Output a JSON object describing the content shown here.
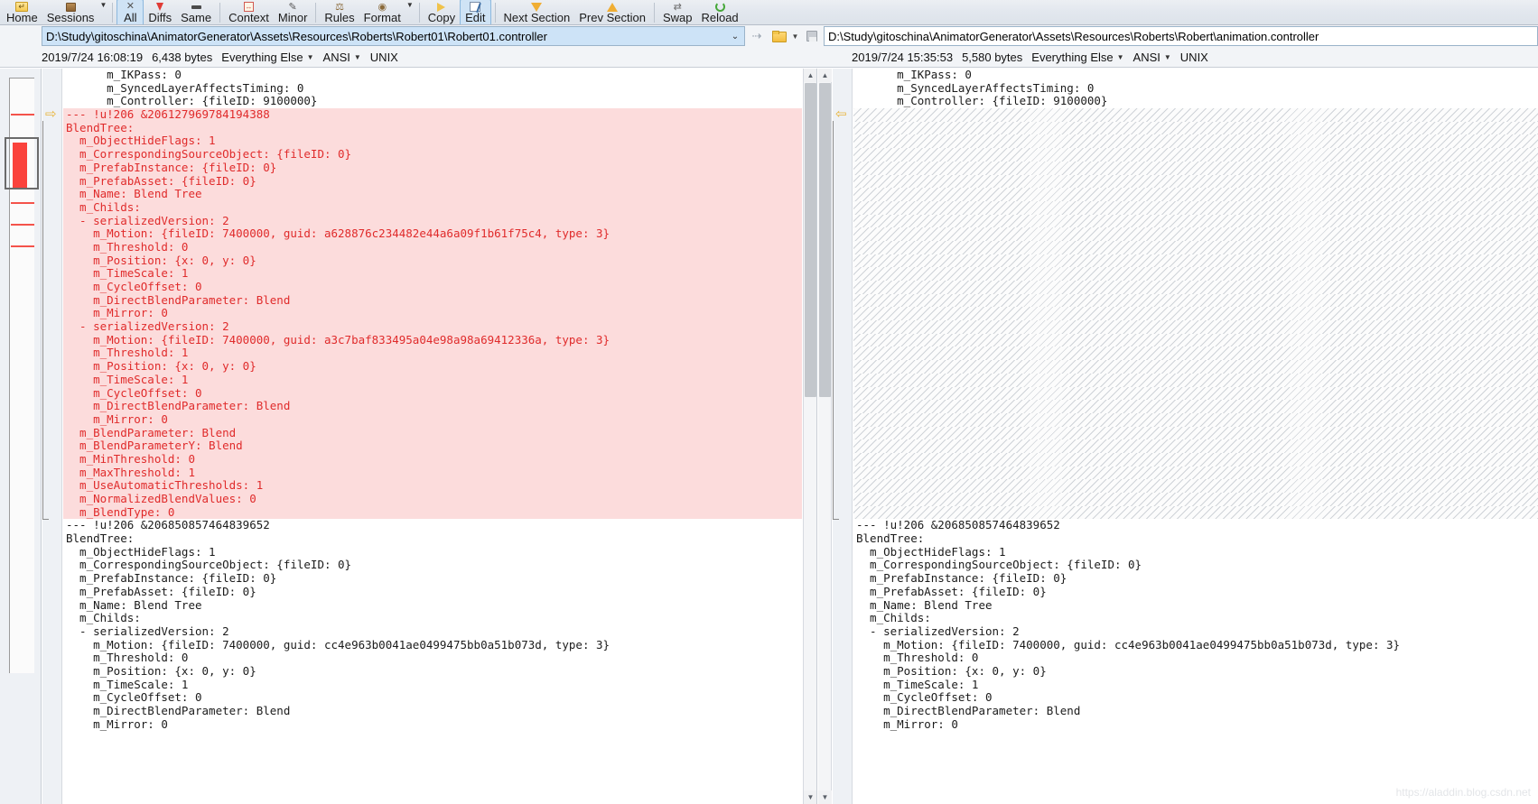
{
  "toolbar": {
    "groups": [
      {
        "items": [
          {
            "label": "Home",
            "icon": "home-folder-icon",
            "active": false
          },
          {
            "label": "Sessions",
            "icon": "sessions-box-icon",
            "active": false,
            "caret": true
          }
        ]
      },
      {
        "items": [
          {
            "label": "All",
            "icon": "all-x-icon",
            "active": true
          },
          {
            "label": "Diffs",
            "icon": "diffs-pin-icon",
            "active": false
          },
          {
            "label": "Same",
            "icon": "same-bar-icon",
            "active": false
          }
        ]
      },
      {
        "items": [
          {
            "label": "Context",
            "icon": "context-icon",
            "active": false
          },
          {
            "label": "Minor",
            "icon": "minor-icon",
            "active": false
          }
        ]
      },
      {
        "items": [
          {
            "label": "Rules",
            "icon": "rules-icon",
            "active": false
          },
          {
            "label": "Format",
            "icon": "format-icon",
            "active": false,
            "caret": true
          }
        ]
      },
      {
        "items": [
          {
            "label": "Copy",
            "icon": "copy-arrow-icon",
            "active": false
          },
          {
            "label": "Edit",
            "icon": "edit-pencil-icon",
            "active": true
          }
        ]
      },
      {
        "items": [
          {
            "label": "Next Section",
            "icon": "next-section-icon",
            "active": false
          },
          {
            "label": "Prev Section",
            "icon": "prev-section-icon",
            "active": false
          }
        ]
      },
      {
        "items": [
          {
            "label": "Swap",
            "icon": "swap-icon",
            "active": false
          },
          {
            "label": "Reload",
            "icon": "reload-icon",
            "active": false
          }
        ]
      }
    ]
  },
  "left_pane": {
    "path": "D:\\Study\\gitoschina\\AnimatorGenerator\\Assets\\Resources\\Roberts\\Robert01\\Robert01.controller",
    "info": {
      "timestamp": "2019/7/24 16:08:19",
      "size": "6,438 bytes",
      "encoding_rule": "Everything Else",
      "charset": "ANSI",
      "line_ending": "UNIX"
    },
    "path_tools": {
      "browse_icon": "navigate-icon",
      "open_icon": "open-folder-icon",
      "open_caret": "chevron-down-icon",
      "save_icon": "save-icon"
    },
    "lines": [
      {
        "text": "      m_IKPass: 0",
        "diff": false
      },
      {
        "text": "      m_SyncedLayerAffectsTiming: 0",
        "diff": false
      },
      {
        "text": "      m_Controller: {fileID: 9100000}",
        "diff": false
      },
      {
        "text": "--- !u!206 &206127969784194388",
        "diff": true
      },
      {
        "text": "BlendTree:",
        "diff": true
      },
      {
        "text": "  m_ObjectHideFlags: 1",
        "diff": true
      },
      {
        "text": "  m_CorrespondingSourceObject: {fileID: 0}",
        "diff": true
      },
      {
        "text": "  m_PrefabInstance: {fileID: 0}",
        "diff": true
      },
      {
        "text": "  m_PrefabAsset: {fileID: 0}",
        "diff": true
      },
      {
        "text": "  m_Name: Blend Tree",
        "diff": true
      },
      {
        "text": "  m_Childs:",
        "diff": true
      },
      {
        "text": "  - serializedVersion: 2",
        "diff": true
      },
      {
        "text": "    m_Motion: {fileID: 7400000, guid: a628876c234482e44a6a09f1b61f75c4, type: 3}",
        "diff": true
      },
      {
        "text": "    m_Threshold: 0",
        "diff": true
      },
      {
        "text": "    m_Position: {x: 0, y: 0}",
        "diff": true
      },
      {
        "text": "    m_TimeScale: 1",
        "diff": true
      },
      {
        "text": "    m_CycleOffset: 0",
        "diff": true
      },
      {
        "text": "    m_DirectBlendParameter: Blend",
        "diff": true
      },
      {
        "text": "    m_Mirror: 0",
        "diff": true
      },
      {
        "text": "  - serializedVersion: 2",
        "diff": true
      },
      {
        "text": "    m_Motion: {fileID: 7400000, guid: a3c7baf833495a04e98a98a69412336a, type: 3}",
        "diff": true
      },
      {
        "text": "    m_Threshold: 1",
        "diff": true
      },
      {
        "text": "    m_Position: {x: 0, y: 0}",
        "diff": true
      },
      {
        "text": "    m_TimeScale: 1",
        "diff": true
      },
      {
        "text": "    m_CycleOffset: 0",
        "diff": true
      },
      {
        "text": "    m_DirectBlendParameter: Blend",
        "diff": true
      },
      {
        "text": "    m_Mirror: 0",
        "diff": true
      },
      {
        "text": "  m_BlendParameter: Blend",
        "diff": true
      },
      {
        "text": "  m_BlendParameterY: Blend",
        "diff": true
      },
      {
        "text": "  m_MinThreshold: 0",
        "diff": true
      },
      {
        "text": "  m_MaxThreshold: 1",
        "diff": true
      },
      {
        "text": "  m_UseAutomaticThresholds: 1",
        "diff": true
      },
      {
        "text": "  m_NormalizedBlendValues: 0",
        "diff": true
      },
      {
        "text": "  m_BlendType: 0",
        "diff": true
      },
      {
        "text": "--- !u!206 &206850857464839652",
        "diff": false
      },
      {
        "text": "BlendTree:",
        "diff": false
      },
      {
        "text": "  m_ObjectHideFlags: 1",
        "diff": false
      },
      {
        "text": "  m_CorrespondingSourceObject: {fileID: 0}",
        "diff": false
      },
      {
        "text": "  m_PrefabInstance: {fileID: 0}",
        "diff": false
      },
      {
        "text": "  m_PrefabAsset: {fileID: 0}",
        "diff": false
      },
      {
        "text": "  m_Name: Blend Tree",
        "diff": false
      },
      {
        "text": "  m_Childs:",
        "diff": false
      },
      {
        "text": "  - serializedVersion: 2",
        "diff": false
      },
      {
        "text": "    m_Motion: {fileID: 7400000, guid: cc4e963b0041ae0499475bb0a51b073d, type: 3}",
        "diff": false
      },
      {
        "text": "    m_Threshold: 0",
        "diff": false
      },
      {
        "text": "    m_Position: {x: 0, y: 0}",
        "diff": false
      },
      {
        "text": "    m_TimeScale: 1",
        "diff": false
      },
      {
        "text": "    m_CycleOffset: 0",
        "diff": false
      },
      {
        "text": "    m_DirectBlendParameter: Blend",
        "diff": false
      },
      {
        "text": "    m_Mirror: 0",
        "diff": false
      }
    ]
  },
  "right_pane": {
    "path": "D:\\Study\\gitoschina\\AnimatorGenerator\\Assets\\Resources\\Roberts\\Robert\\animation.controller",
    "info": {
      "timestamp": "2019/7/24 15:35:53",
      "size": "5,580 bytes",
      "encoding_rule": "Everything Else",
      "charset": "ANSI",
      "line_ending": "UNIX"
    },
    "path_tools": {
      "browse_icon": "navigate-icon",
      "open_icon": "open-folder-icon",
      "open_caret": "chevron-down-icon",
      "save_icon": "save-icon"
    },
    "lines": [
      {
        "text": "      m_IKPass: 0",
        "diff": false,
        "hatch": false
      },
      {
        "text": "      m_SyncedLayerAffectsTiming: 0",
        "diff": false,
        "hatch": false
      },
      {
        "text": "      m_Controller: {fileID: 9100000}",
        "diff": false,
        "hatch": false
      },
      {
        "text": "",
        "diff": false,
        "hatch": true
      },
      {
        "text": "",
        "diff": false,
        "hatch": true
      },
      {
        "text": "",
        "diff": false,
        "hatch": true
      },
      {
        "text": "",
        "diff": false,
        "hatch": true
      },
      {
        "text": "",
        "diff": false,
        "hatch": true
      },
      {
        "text": "",
        "diff": false,
        "hatch": true
      },
      {
        "text": "",
        "diff": false,
        "hatch": true
      },
      {
        "text": "",
        "diff": false,
        "hatch": true
      },
      {
        "text": "",
        "diff": false,
        "hatch": true
      },
      {
        "text": "",
        "diff": false,
        "hatch": true
      },
      {
        "text": "",
        "diff": false,
        "hatch": true
      },
      {
        "text": "",
        "diff": false,
        "hatch": true
      },
      {
        "text": "",
        "diff": false,
        "hatch": true
      },
      {
        "text": "",
        "diff": false,
        "hatch": true
      },
      {
        "text": "",
        "diff": false,
        "hatch": true
      },
      {
        "text": "",
        "diff": false,
        "hatch": true
      },
      {
        "text": "",
        "diff": false,
        "hatch": true
      },
      {
        "text": "",
        "diff": false,
        "hatch": true
      },
      {
        "text": "",
        "diff": false,
        "hatch": true
      },
      {
        "text": "",
        "diff": false,
        "hatch": true
      },
      {
        "text": "",
        "diff": false,
        "hatch": true
      },
      {
        "text": "",
        "diff": false,
        "hatch": true
      },
      {
        "text": "",
        "diff": false,
        "hatch": true
      },
      {
        "text": "",
        "diff": false,
        "hatch": true
      },
      {
        "text": "",
        "diff": false,
        "hatch": true
      },
      {
        "text": "",
        "diff": false,
        "hatch": true
      },
      {
        "text": "",
        "diff": false,
        "hatch": true
      },
      {
        "text": "",
        "diff": false,
        "hatch": true
      },
      {
        "text": "",
        "diff": false,
        "hatch": true
      },
      {
        "text": "",
        "diff": false,
        "hatch": true
      },
      {
        "text": "",
        "diff": false,
        "hatch": true
      },
      {
        "text": "--- !u!206 &206850857464839652",
        "diff": false,
        "hatch": false
      },
      {
        "text": "BlendTree:",
        "diff": false,
        "hatch": false
      },
      {
        "text": "  m_ObjectHideFlags: 1",
        "diff": false,
        "hatch": false
      },
      {
        "text": "  m_CorrespondingSourceObject: {fileID: 0}",
        "diff": false,
        "hatch": false
      },
      {
        "text": "  m_PrefabInstance: {fileID: 0}",
        "diff": false,
        "hatch": false
      },
      {
        "text": "  m_PrefabAsset: {fileID: 0}",
        "diff": false,
        "hatch": false
      },
      {
        "text": "  m_Name: Blend Tree",
        "diff": false,
        "hatch": false
      },
      {
        "text": "  m_Childs:",
        "diff": false,
        "hatch": false
      },
      {
        "text": "  - serializedVersion: 2",
        "diff": false,
        "hatch": false
      },
      {
        "text": "    m_Motion: {fileID: 7400000, guid: cc4e963b0041ae0499475bb0a51b073d, type: 3}",
        "diff": false,
        "hatch": false
      },
      {
        "text": "    m_Threshold: 0",
        "diff": false,
        "hatch": false
      },
      {
        "text": "    m_Position: {x: 0, y: 0}",
        "diff": false,
        "hatch": false
      },
      {
        "text": "    m_TimeScale: 1",
        "diff": false,
        "hatch": false
      },
      {
        "text": "    m_CycleOffset: 0",
        "diff": false,
        "hatch": false
      },
      {
        "text": "    m_DirectBlendParameter: Blend",
        "diff": false,
        "hatch": false
      },
      {
        "text": "    m_Mirror: 0",
        "diff": false,
        "hatch": false
      }
    ]
  },
  "minimap": {
    "diff_lines_pct": [
      6,
      50,
      62,
      74
    ],
    "block": {
      "top_pct": 14,
      "height_pct": 13
    },
    "viewport": {
      "top_pct": 12,
      "height_pct": 19
    }
  },
  "watermark": "https://aladdin.blog.csdn.net",
  "colors": {
    "diff_bg": "#fcdcdc",
    "diff_fg": "#e02b2b",
    "accent": "#cde3f7",
    "toolbar_bg": "#e4e9ef"
  }
}
